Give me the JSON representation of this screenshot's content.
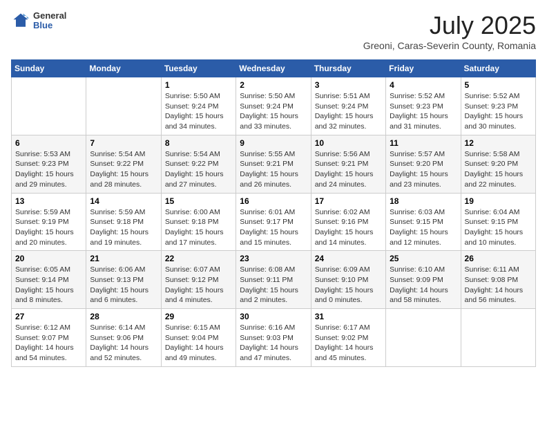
{
  "logo": {
    "general": "General",
    "blue": "Blue"
  },
  "title": "July 2025",
  "subtitle": "Greoni, Caras-Severin County, Romania",
  "headers": [
    "Sunday",
    "Monday",
    "Tuesday",
    "Wednesday",
    "Thursday",
    "Friday",
    "Saturday"
  ],
  "weeks": [
    [
      {
        "day": "",
        "sunrise": "",
        "sunset": "",
        "daylight": ""
      },
      {
        "day": "",
        "sunrise": "",
        "sunset": "",
        "daylight": ""
      },
      {
        "day": "1",
        "sunrise": "Sunrise: 5:50 AM",
        "sunset": "Sunset: 9:24 PM",
        "daylight": "Daylight: 15 hours and 34 minutes."
      },
      {
        "day": "2",
        "sunrise": "Sunrise: 5:50 AM",
        "sunset": "Sunset: 9:24 PM",
        "daylight": "Daylight: 15 hours and 33 minutes."
      },
      {
        "day": "3",
        "sunrise": "Sunrise: 5:51 AM",
        "sunset": "Sunset: 9:24 PM",
        "daylight": "Daylight: 15 hours and 32 minutes."
      },
      {
        "day": "4",
        "sunrise": "Sunrise: 5:52 AM",
        "sunset": "Sunset: 9:23 PM",
        "daylight": "Daylight: 15 hours and 31 minutes."
      },
      {
        "day": "5",
        "sunrise": "Sunrise: 5:52 AM",
        "sunset": "Sunset: 9:23 PM",
        "daylight": "Daylight: 15 hours and 30 minutes."
      }
    ],
    [
      {
        "day": "6",
        "sunrise": "Sunrise: 5:53 AM",
        "sunset": "Sunset: 9:23 PM",
        "daylight": "Daylight: 15 hours and 29 minutes."
      },
      {
        "day": "7",
        "sunrise": "Sunrise: 5:54 AM",
        "sunset": "Sunset: 9:22 PM",
        "daylight": "Daylight: 15 hours and 28 minutes."
      },
      {
        "day": "8",
        "sunrise": "Sunrise: 5:54 AM",
        "sunset": "Sunset: 9:22 PM",
        "daylight": "Daylight: 15 hours and 27 minutes."
      },
      {
        "day": "9",
        "sunrise": "Sunrise: 5:55 AM",
        "sunset": "Sunset: 9:21 PM",
        "daylight": "Daylight: 15 hours and 26 minutes."
      },
      {
        "day": "10",
        "sunrise": "Sunrise: 5:56 AM",
        "sunset": "Sunset: 9:21 PM",
        "daylight": "Daylight: 15 hours and 24 minutes."
      },
      {
        "day": "11",
        "sunrise": "Sunrise: 5:57 AM",
        "sunset": "Sunset: 9:20 PM",
        "daylight": "Daylight: 15 hours and 23 minutes."
      },
      {
        "day": "12",
        "sunrise": "Sunrise: 5:58 AM",
        "sunset": "Sunset: 9:20 PM",
        "daylight": "Daylight: 15 hours and 22 minutes."
      }
    ],
    [
      {
        "day": "13",
        "sunrise": "Sunrise: 5:59 AM",
        "sunset": "Sunset: 9:19 PM",
        "daylight": "Daylight: 15 hours and 20 minutes."
      },
      {
        "day": "14",
        "sunrise": "Sunrise: 5:59 AM",
        "sunset": "Sunset: 9:18 PM",
        "daylight": "Daylight: 15 hours and 19 minutes."
      },
      {
        "day": "15",
        "sunrise": "Sunrise: 6:00 AM",
        "sunset": "Sunset: 9:18 PM",
        "daylight": "Daylight: 15 hours and 17 minutes."
      },
      {
        "day": "16",
        "sunrise": "Sunrise: 6:01 AM",
        "sunset": "Sunset: 9:17 PM",
        "daylight": "Daylight: 15 hours and 15 minutes."
      },
      {
        "day": "17",
        "sunrise": "Sunrise: 6:02 AM",
        "sunset": "Sunset: 9:16 PM",
        "daylight": "Daylight: 15 hours and 14 minutes."
      },
      {
        "day": "18",
        "sunrise": "Sunrise: 6:03 AM",
        "sunset": "Sunset: 9:15 PM",
        "daylight": "Daylight: 15 hours and 12 minutes."
      },
      {
        "day": "19",
        "sunrise": "Sunrise: 6:04 AM",
        "sunset": "Sunset: 9:15 PM",
        "daylight": "Daylight: 15 hours and 10 minutes."
      }
    ],
    [
      {
        "day": "20",
        "sunrise": "Sunrise: 6:05 AM",
        "sunset": "Sunset: 9:14 PM",
        "daylight": "Daylight: 15 hours and 8 minutes."
      },
      {
        "day": "21",
        "sunrise": "Sunrise: 6:06 AM",
        "sunset": "Sunset: 9:13 PM",
        "daylight": "Daylight: 15 hours and 6 minutes."
      },
      {
        "day": "22",
        "sunrise": "Sunrise: 6:07 AM",
        "sunset": "Sunset: 9:12 PM",
        "daylight": "Daylight: 15 hours and 4 minutes."
      },
      {
        "day": "23",
        "sunrise": "Sunrise: 6:08 AM",
        "sunset": "Sunset: 9:11 PM",
        "daylight": "Daylight: 15 hours and 2 minutes."
      },
      {
        "day": "24",
        "sunrise": "Sunrise: 6:09 AM",
        "sunset": "Sunset: 9:10 PM",
        "daylight": "Daylight: 15 hours and 0 minutes."
      },
      {
        "day": "25",
        "sunrise": "Sunrise: 6:10 AM",
        "sunset": "Sunset: 9:09 PM",
        "daylight": "Daylight: 14 hours and 58 minutes."
      },
      {
        "day": "26",
        "sunrise": "Sunrise: 6:11 AM",
        "sunset": "Sunset: 9:08 PM",
        "daylight": "Daylight: 14 hours and 56 minutes."
      }
    ],
    [
      {
        "day": "27",
        "sunrise": "Sunrise: 6:12 AM",
        "sunset": "Sunset: 9:07 PM",
        "daylight": "Daylight: 14 hours and 54 minutes."
      },
      {
        "day": "28",
        "sunrise": "Sunrise: 6:14 AM",
        "sunset": "Sunset: 9:06 PM",
        "daylight": "Daylight: 14 hours and 52 minutes."
      },
      {
        "day": "29",
        "sunrise": "Sunrise: 6:15 AM",
        "sunset": "Sunset: 9:04 PM",
        "daylight": "Daylight: 14 hours and 49 minutes."
      },
      {
        "day": "30",
        "sunrise": "Sunrise: 6:16 AM",
        "sunset": "Sunset: 9:03 PM",
        "daylight": "Daylight: 14 hours and 47 minutes."
      },
      {
        "day": "31",
        "sunrise": "Sunrise: 6:17 AM",
        "sunset": "Sunset: 9:02 PM",
        "daylight": "Daylight: 14 hours and 45 minutes."
      },
      {
        "day": "",
        "sunrise": "",
        "sunset": "",
        "daylight": ""
      },
      {
        "day": "",
        "sunrise": "",
        "sunset": "",
        "daylight": ""
      }
    ]
  ]
}
